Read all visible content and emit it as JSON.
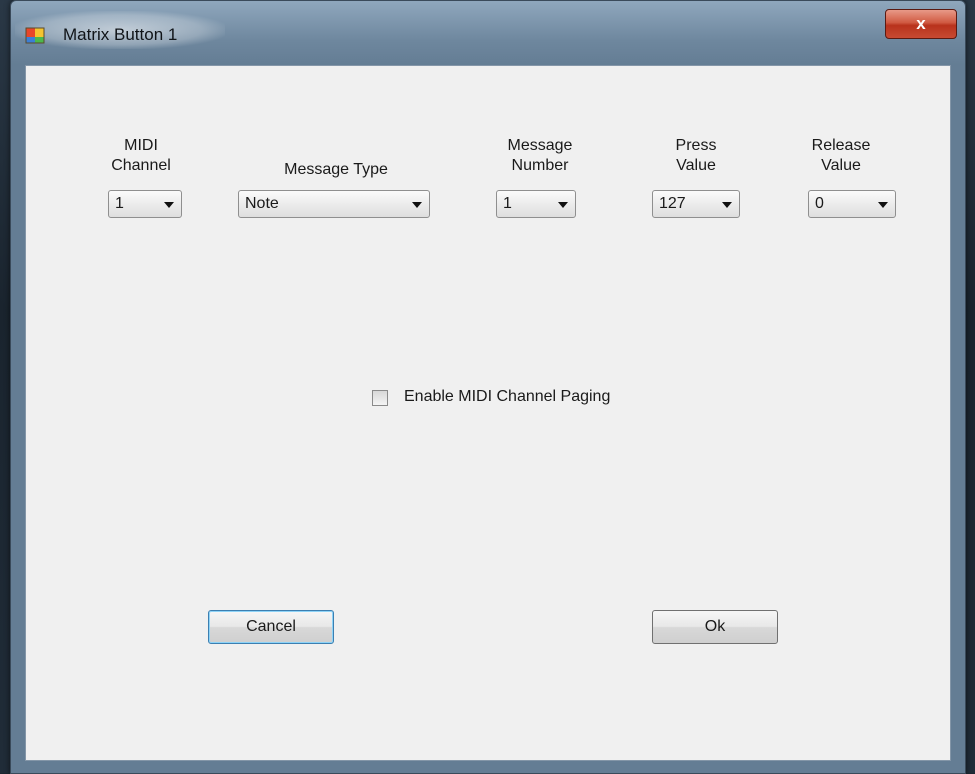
{
  "window": {
    "title": "Matrix Button 1",
    "close_label": "x"
  },
  "fields": {
    "midi_channel": {
      "label": "MIDI\nChannel",
      "value": "1"
    },
    "message_type": {
      "label": "Message Type",
      "value": "Note"
    },
    "message_number": {
      "label": "Message\nNumber",
      "value": "1"
    },
    "press_value": {
      "label": "Press\nValue",
      "value": "127"
    },
    "release_value": {
      "label": "Release\nValue",
      "value": "0"
    }
  },
  "paging": {
    "label": "Enable MIDI Channel Paging",
    "checked": false
  },
  "buttons": {
    "cancel_label": "Cancel",
    "ok_label": "Ok"
  },
  "colors": {
    "close_button": "#c84a32",
    "default_button_border": "#3c7fb1",
    "client_background": "#f0f0f0"
  }
}
